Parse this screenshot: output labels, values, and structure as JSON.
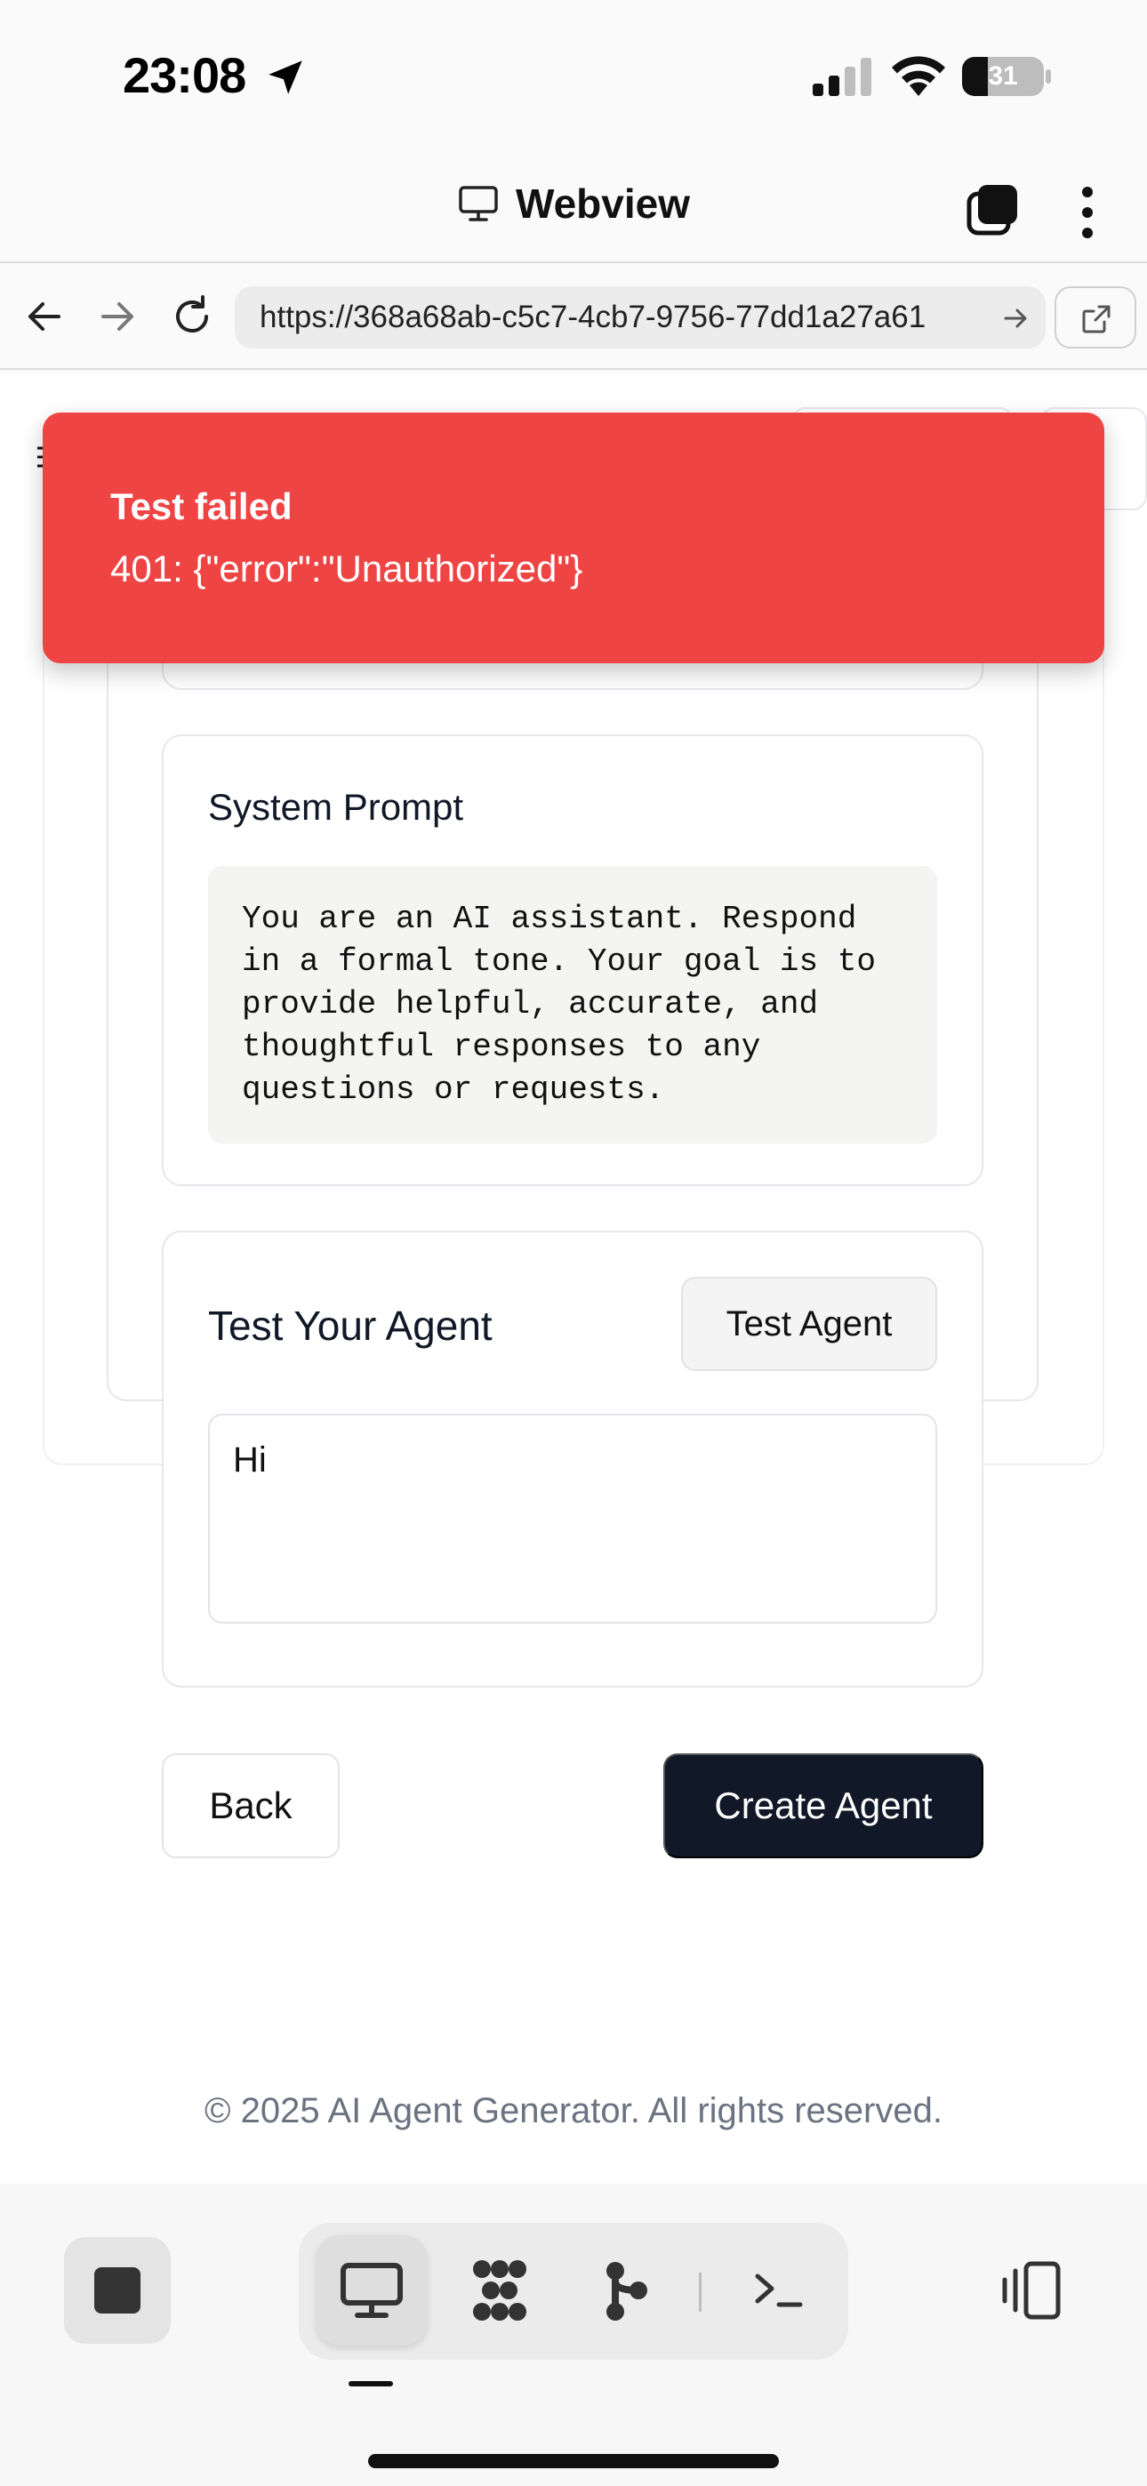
{
  "status_bar": {
    "time": "23:08",
    "battery_level": "31",
    "battery_fraction": 0.31,
    "icons": [
      "location-arrow-icon",
      "cellular-signal-icon",
      "wifi-icon",
      "battery-icon"
    ]
  },
  "webview_header": {
    "title": "Webview",
    "icons": [
      "monitor-icon",
      "tabs-icon",
      "more-vertical-icon"
    ]
  },
  "url_bar": {
    "url": "https://368a68ab-c5c7-4cb7-9756-77dd1a27a61",
    "icons": [
      "back-arrow-icon",
      "forward-arrow-icon",
      "reload-icon",
      "go-arrow-icon",
      "open-external-icon"
    ]
  },
  "toast": {
    "title": "Test failed",
    "message": "401: {\"error\":\"Unauthorized\"}",
    "color": "#ef4444"
  },
  "system_prompt": {
    "title": "System Prompt",
    "text": "You are an AI assistant. Respond\nin a formal tone. Your goal is to\nprovide helpful, accurate, and\nthoughtful responses to any\nquestions or requests."
  },
  "test_agent": {
    "title": "Test Your Agent",
    "button_label": "Test Agent",
    "input_value": "Hi"
  },
  "actions": {
    "back_label": "Back",
    "create_label": "Create Agent",
    "create_color": "#111827"
  },
  "footer": {
    "text": "© 2025 AI Agent Generator. All rights reserved."
  },
  "bottom_toolbar": {
    "items": [
      "stop-icon",
      "preview-monitor-icon",
      "dots-grid-icon",
      "branch-icon",
      "terminal-icon",
      "panel-toggle-icon"
    ],
    "active_item": "preview-monitor-icon"
  }
}
